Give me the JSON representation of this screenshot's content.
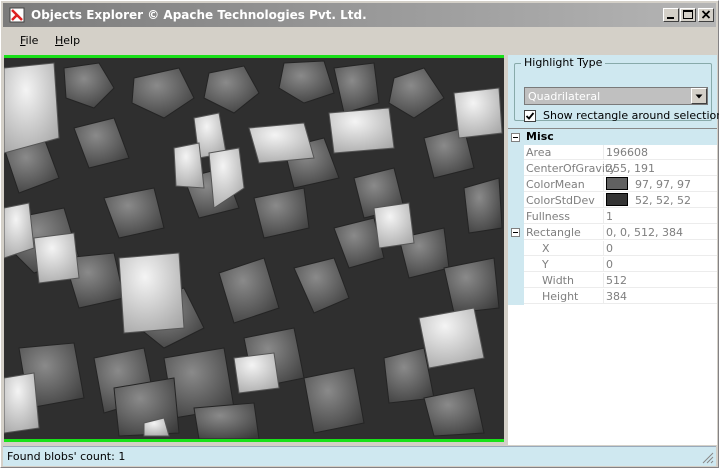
{
  "window": {
    "title": "Objects Explorer © Apache Technologies Pvt. Ltd."
  },
  "menu": [
    {
      "access_key": "F",
      "rest": "ile"
    },
    {
      "access_key": "H",
      "rest": "elp"
    }
  ],
  "highlight": {
    "legend": "Highlight Type",
    "selected": "Quadrilateral",
    "show_rect_label": "Show rectangle around selection",
    "show_rect_checked": true
  },
  "properties": {
    "section": "Misc",
    "rows": [
      {
        "name": "Area",
        "value": "196608"
      },
      {
        "name": "CenterOfGravity",
        "value": "255, 191"
      },
      {
        "name": "ColorMean",
        "value": "97, 97, 97",
        "swatch": "#616161"
      },
      {
        "name": "ColorStdDev",
        "value": "52, 52, 52",
        "swatch": "#343434"
      },
      {
        "name": "Fullness",
        "value": "1"
      },
      {
        "name": "Rectangle",
        "value": "0, 0, 512, 384"
      },
      {
        "name": "X",
        "value": "0"
      },
      {
        "name": "Y",
        "value": "0"
      },
      {
        "name": "Width",
        "value": "512"
      },
      {
        "name": "Height",
        "value": "384"
      }
    ]
  },
  "status": {
    "text": "Found blobs' count: 1"
  },
  "colors": {
    "highlight": "#19e119",
    "panel": "#cfe8f0"
  }
}
